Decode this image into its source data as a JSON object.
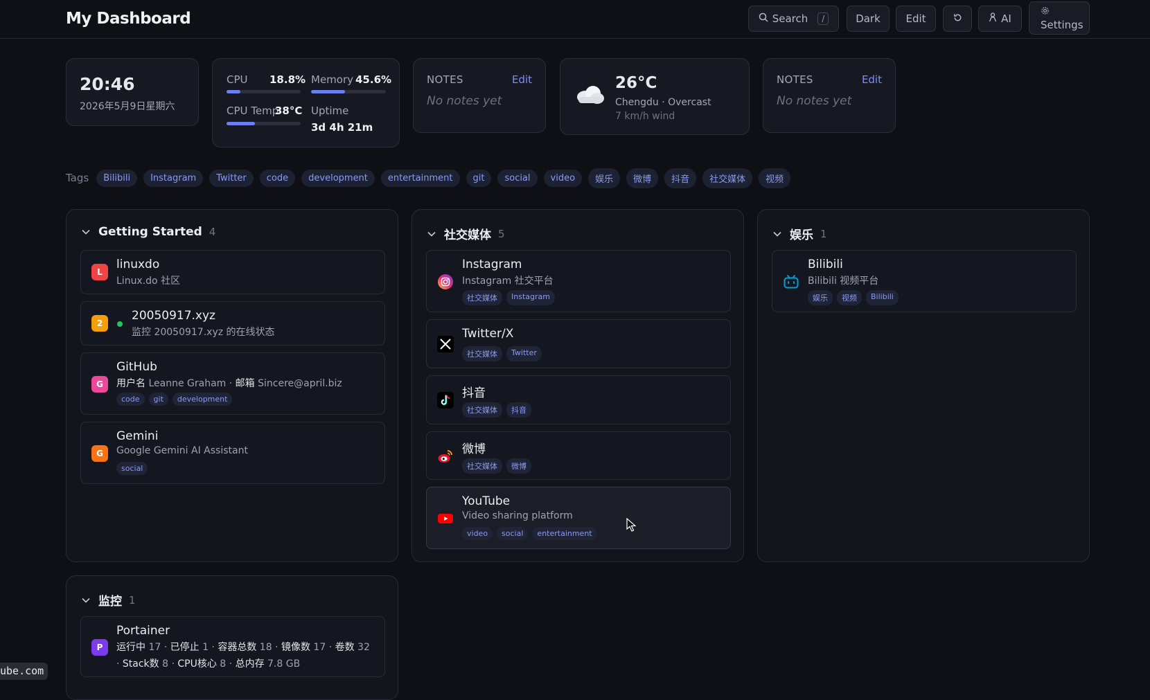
{
  "header": {
    "title": "My Dashboard",
    "search_label": "Search",
    "search_shortcut": "/",
    "dark_label": "Dark",
    "edit_label": "Edit",
    "ai_label": "AI",
    "settings_label": "Settings"
  },
  "clock": {
    "time": "20:46",
    "date": "2026年5月9日星期六"
  },
  "system": {
    "cpu_label": "CPU",
    "cpu_value": "18.8%",
    "cpu_fraction": 0.188,
    "memory_label": "Memory",
    "memory_value": "45.6%",
    "memory_fraction": 0.456,
    "temp_label": "CPU Temp",
    "temp_value": "38°C",
    "temp_fraction": 0.38,
    "uptime_label": "Uptime",
    "uptime_value": "3d 4h 21m"
  },
  "notes1": {
    "title": "NOTES",
    "edit": "Edit",
    "empty": "No notes yet"
  },
  "notes2": {
    "title": "NOTES",
    "edit": "Edit",
    "empty": "No notes yet"
  },
  "weather": {
    "temp": "26°C",
    "location": "Chengdu · Overcast",
    "wind": "7 km/h wind",
    "icon": "cloud-icon"
  },
  "tags": {
    "label": "Tags",
    "items": [
      "Bilibili",
      "Instagram",
      "Twitter",
      "code",
      "development",
      "entertainment",
      "git",
      "social",
      "video",
      "娱乐",
      "微博",
      "抖音",
      "社交媒体",
      "视频"
    ]
  },
  "groups": {
    "getting_started": {
      "title": "Getting Started",
      "count": "4",
      "items": [
        {
          "letter": "L",
          "name": "linuxdo",
          "desc": "Linux.do 社区"
        },
        {
          "letter": "2",
          "name": "20050917.xyz",
          "desc": "监控 20050917.xyz 的在线状态"
        },
        {
          "letter": "G",
          "name": "GitHub",
          "desc_k1": "用户名",
          "desc_v1": "Leanne Graham",
          "desc_sep": "·",
          "desc_k2": "邮箱",
          "desc_v2": "Sincere@april.biz",
          "tags": [
            "code",
            "git",
            "development"
          ]
        },
        {
          "letter": "G",
          "name": "Gemini",
          "desc": "Google Gemini AI Assistant",
          "tags": [
            "social"
          ]
        }
      ]
    },
    "social": {
      "title": "社交媒体",
      "count": "5",
      "items": [
        {
          "name": "Instagram",
          "desc": "Instagram 社交平台",
          "tags": [
            "社交媒体",
            "Instagram"
          ]
        },
        {
          "name": "Twitter/X",
          "tags": [
            "社交媒体",
            "Twitter"
          ]
        },
        {
          "name": "抖音",
          "tags": [
            "社交媒体",
            "抖音"
          ]
        },
        {
          "name": "微博",
          "tags": [
            "社交媒体",
            "微博"
          ]
        },
        {
          "name": "YouTube",
          "desc": "Video sharing platform",
          "tags": [
            "video",
            "social",
            "entertainment"
          ]
        }
      ]
    },
    "entertainment": {
      "title": "娱乐",
      "count": "1",
      "items": [
        {
          "name": "Bilibili",
          "desc": "Bilibili 视频平台",
          "tags": [
            "娱乐",
            "视频",
            "Bilibili"
          ]
        }
      ]
    },
    "monitor": {
      "title": "监控",
      "count": "1",
      "items": [
        {
          "letter": "P",
          "name": "Portainer",
          "line1": [
            [
              "运行中",
              "17"
            ],
            [
              "已停止",
              "1"
            ],
            [
              "容器总数",
              "18"
            ],
            [
              "镜像数",
              "17"
            ],
            [
              "卷数",
              "32"
            ]
          ],
          "line2": [
            [
              "Stack数",
              "8"
            ],
            [
              "CPU核心",
              "8"
            ],
            [
              "总内存",
              "7.8 GB"
            ]
          ]
        }
      ]
    }
  },
  "status_toast": "ube.com",
  "colors": {
    "accent": "#6b7ff0",
    "background": "#0f1016",
    "online": "#22c55e"
  }
}
